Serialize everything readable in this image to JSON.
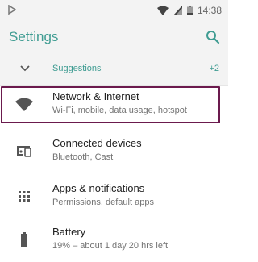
{
  "status_bar": {
    "time": "14:38",
    "icons": [
      "notification-icon",
      "wifi-icon",
      "signal-icon",
      "battery-icon"
    ]
  },
  "app_bar": {
    "title": "Settings",
    "search_icon": "search-icon"
  },
  "suggestions": {
    "label": "Suggestions",
    "count": "+2",
    "icon": "chevron-down-icon"
  },
  "items": [
    {
      "title": "Network & Internet",
      "subtitle": "Wi-Fi, mobile, data usage, hotspot",
      "icon": "wifi-icon",
      "highlighted": true
    },
    {
      "title": "Connected devices",
      "subtitle": "Bluetooth, Cast",
      "icon": "devices-icon"
    },
    {
      "title": "Apps & notifications",
      "subtitle": "Permissions, default apps",
      "icon": "apps-grid-icon"
    },
    {
      "title": "Battery",
      "subtitle": "19% – about 1 day 20 hrs left",
      "icon": "battery-icon"
    }
  ],
  "colors": {
    "accent": "#3f9c92",
    "highlight_border": "#6b1a4d",
    "header_bg": "#f3f3f3"
  }
}
